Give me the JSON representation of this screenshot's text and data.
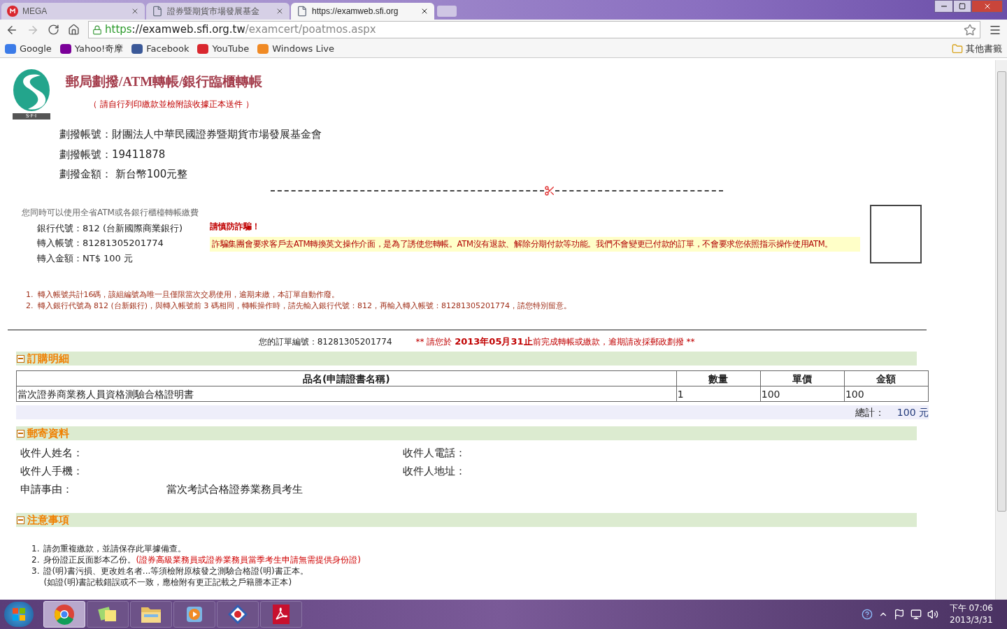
{
  "browser": {
    "tabs": [
      {
        "title": "MEGA",
        "kind": "mega",
        "selected": false
      },
      {
        "title": "證券暨期貨市場發展基金",
        "kind": "page",
        "selected": false
      },
      {
        "title": "https://examweb.sfi.org",
        "kind": "page",
        "selected": true
      }
    ],
    "url": [
      {
        "kind": "scheme",
        "text": "https"
      },
      {
        "kind": "host",
        "text": "://examweb.sfi.org.tw"
      },
      {
        "kind": "path",
        "text": "/examcert/poatmos.aspx"
      }
    ],
    "bookmarks": [
      {
        "kind": "google",
        "label": "Google"
      },
      {
        "kind": "yahoo",
        "label": "Yahoo!奇摩"
      },
      {
        "kind": "facebook",
        "label": "Facebook"
      },
      {
        "kind": "youtube",
        "label": "YouTube"
      },
      {
        "kind": "live",
        "label": "Windows Live"
      }
    ],
    "other_bookmarks": "其他書籤"
  },
  "page": {
    "logo_text": "S·F·I",
    "title": "郵局劃撥/ATM轉帳/銀行臨櫃轉帳",
    "subtitle": "（ 請自行列印繳款並檢附該收據正本送件 ）",
    "giro": [
      {
        "label": "劃撥帳號：",
        "value": "財團法人中華民國證券暨期貨市場發展基金會"
      },
      {
        "label": "劃撥帳號：",
        "value": "19411878"
      },
      {
        "label": "劃撥金額：",
        "value": " 新台幣100元整"
      }
    ],
    "atm": {
      "intro": "您同時可以使用全省ATM或各銀行櫃檯轉帳繳費",
      "lines": [
        {
          "label": "銀行代號：",
          "value": "812 (台新國際商業銀行)"
        },
        {
          "label": "轉入帳號：",
          "value": "81281305201774"
        },
        {
          "label": "轉入金額：",
          "value": "NT$ 100 元"
        }
      ],
      "warning_title": "請慎防詐騙！",
      "warning_text": "詐騙集團會要求客戶去ATM轉換英文操作介面，是為了誘使您轉帳。ATM沒有退款、解除分期付款等功能。我們不會變更已付款的訂單，不會要求您依照指示操作使用ATM。"
    },
    "atm_notes": [
      {
        "number": "1.",
        "text": "轉入帳號共計16碼，該組編號為唯一且僅限當次交易使用，逾期未繳，本訂單自動作廢。"
      },
      {
        "number": "2.",
        "text": "轉入銀行代號為 812 (台新銀行)，與轉入帳號前 3 碼相同，轉帳操作時，請先輸入銀行代號：812，再輸入轉入帳號：81281305201774，請您特別留意。"
      }
    ],
    "order": {
      "label": "您的訂單編號：",
      "number": "81281305201774",
      "marks_before": "**",
      "before": "請您於",
      "date": "2013年05月31止",
      "after": "前完成轉帳或繳款，逾期請改採郵政劃撥",
      "marks_after": "**"
    },
    "order_section": {
      "title": "訂購明細",
      "expanded": true,
      "columns": [
        "品名(申請證書名稱)",
        "數量",
        "單價",
        "金額"
      ],
      "rows": [
        [
          "當次證券商業務人員資格測驗合格證明書",
          "1",
          "100",
          "100"
        ]
      ],
      "total_label": "總計：",
      "total_value": "100 元"
    },
    "mail_section": {
      "title": "郵寄資料",
      "expanded": true,
      "fields": [
        {
          "label": "收件人姓名："
        },
        {
          "label": "收件人電話："
        },
        {
          "label": "收件人手機："
        },
        {
          "label": "收件人地址："
        }
      ],
      "reason_label": "申請事由：",
      "reason_value": "當次考試合格證券業務員考生"
    },
    "notes_section": {
      "title": "注意事項",
      "expanded": true,
      "items": [
        {
          "number": "1.",
          "text": "請勿重複繳款，並請保存此單據備查。"
        },
        {
          "number": "2.",
          "text": "身份證正反面影本乙份。",
          "red": "(證券高級業務員或證券業務員當季考生申請無需提供身份證)"
        },
        {
          "number": "3.",
          "text": "證(明)書污損、更改姓名者...等須檢附原核發之測驗合格證(明)書正本。",
          "extra": "(如證(明)書記載錯誤或不一致，應檢附有更正記載之戶籍謄本正本)"
        }
      ]
    }
  },
  "taskbar": {
    "apps": [
      {
        "kind": "chrome",
        "selected": true
      },
      {
        "kind": "notes",
        "selected": false
      },
      {
        "kind": "explorer",
        "selected": false
      },
      {
        "kind": "media",
        "selected": false
      },
      {
        "kind": "tool",
        "selected": false
      },
      {
        "kind": "pdf",
        "selected": false
      }
    ],
    "time": "下午 07:06",
    "date": "2013/3/31"
  }
}
